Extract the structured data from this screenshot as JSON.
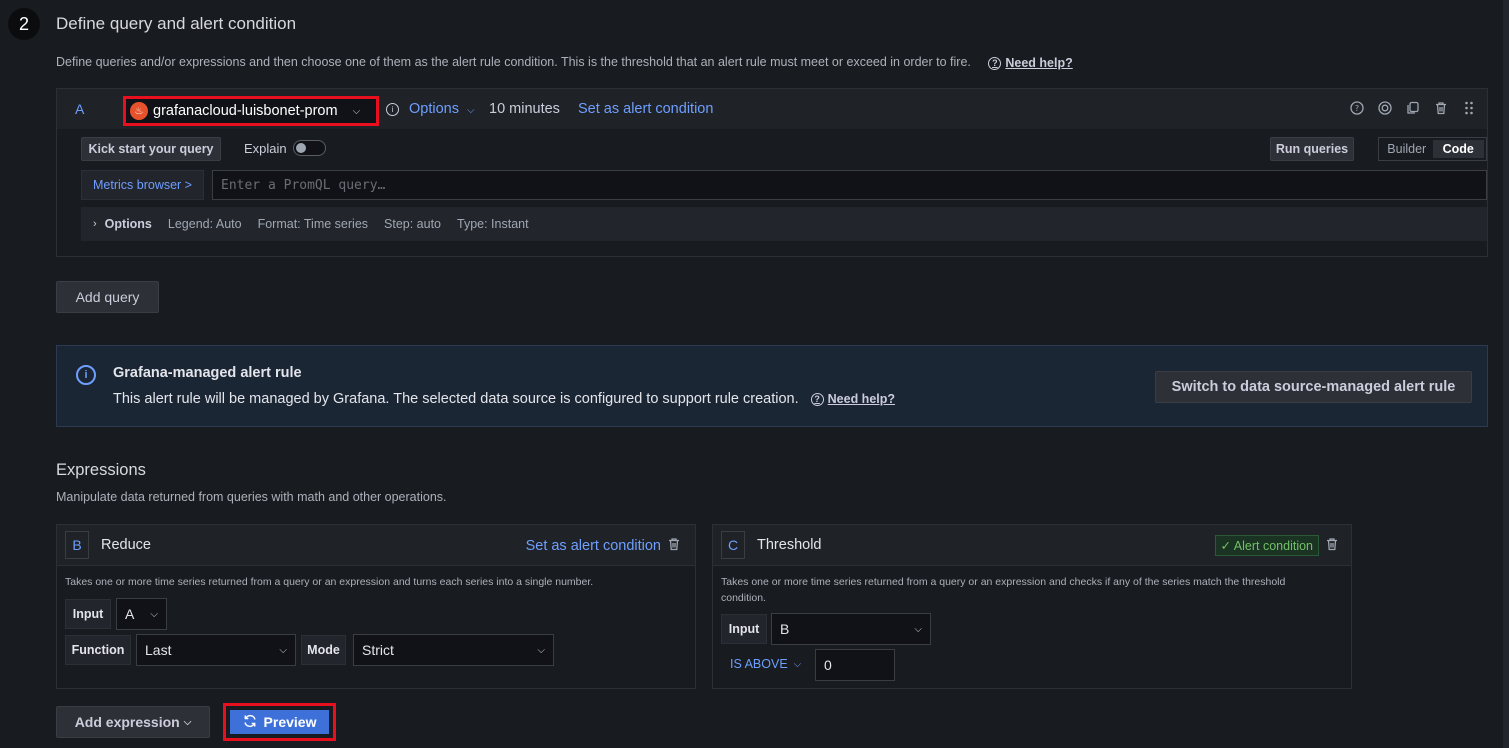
{
  "step": {
    "number": "2",
    "title": "Define query and alert condition",
    "description": "Define queries and/or expressions and then choose one of them as the alert rule condition. This is the threshold that an alert rule must meet or exceed in order to fire.",
    "help_label": "Need help?"
  },
  "query": {
    "letter": "A",
    "datasource": "grafanacloud-luisbonet-prom",
    "options_label": "Options",
    "interval": "10 minutes",
    "set_alert_label": "Set as alert condition",
    "kick_start_label": "Kick start your query",
    "explain_label": "Explain",
    "run_queries_label": "Run queries",
    "modes": [
      "Builder",
      "Code"
    ],
    "active_mode": "Code",
    "metrics_browser_label": "Metrics browser >",
    "promql_placeholder": "Enter a PromQL query…",
    "options_row": {
      "label": "Options",
      "legend": "Legend: Auto",
      "format": "Format: Time series",
      "step": "Step: auto",
      "type": "Type: Instant"
    }
  },
  "add_query_label": "Add query",
  "alert_info": {
    "title": "Grafana-managed alert rule",
    "text": "This alert rule will be managed by Grafana. The selected data source is configured to support rule creation.",
    "help_label": "Need help?",
    "switch_label": "Switch to data source-managed alert rule"
  },
  "expressions": {
    "title": "Expressions",
    "description": "Manipulate data returned from queries with math and other operations.",
    "reduce": {
      "letter": "B",
      "name": "Reduce",
      "set_alert_label": "Set as alert condition",
      "description": "Takes one or more time series returned from a query or an expression and turns each series into a single number.",
      "input_label": "Input",
      "input_value": "A",
      "function_label": "Function",
      "function_value": "Last",
      "mode_label": "Mode",
      "mode_value": "Strict"
    },
    "threshold": {
      "letter": "C",
      "name": "Threshold",
      "badge": "✓ Alert condition",
      "description": "Takes one or more time series returned from a query or an expression and checks if any of the series match the threshold condition.",
      "input_label": "Input",
      "input_value": "B",
      "operator": "IS ABOVE",
      "threshold_value": "0"
    }
  },
  "add_expression_label": "Add expression",
  "preview_label": "Preview",
  "colors": {
    "accent": "#6e9fff",
    "highlight": "#e8101f",
    "primary_button": "#3d71d9",
    "success": "#73bf69"
  }
}
